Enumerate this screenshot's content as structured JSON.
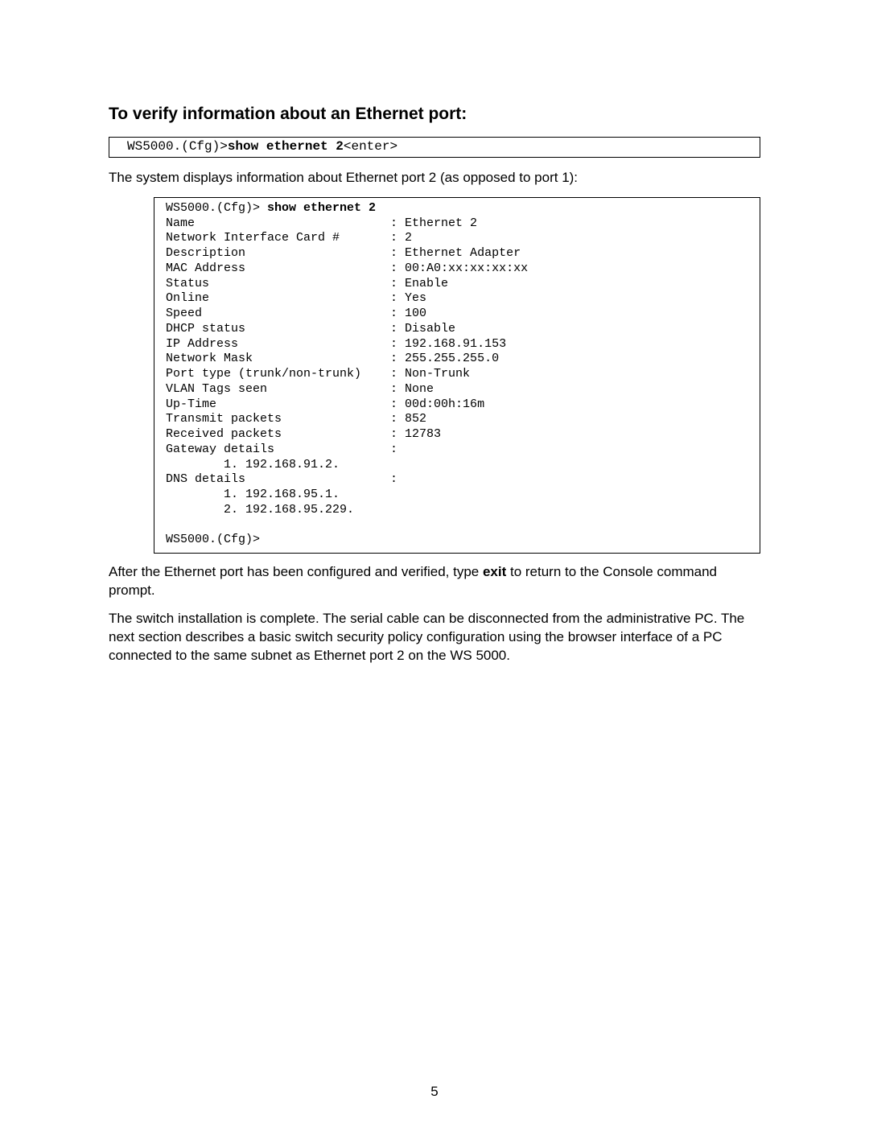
{
  "heading": "To verify information about an Ethernet port:",
  "cmd": {
    "prompt": "WS5000.(Cfg)>",
    "bold_cmd": "show ethernet 2",
    "suffix": "<enter>"
  },
  "intro_text": "The system displays information about Ethernet port 2 (as opposed to port 1):",
  "output": {
    "prompt_line_prefix": "WS5000.(Cfg)> ",
    "prompt_line_cmd": "show ethernet 2",
    "rows": [
      {
        "label": "Name",
        "value": "Ethernet 2"
      },
      {
        "label": "Network Interface Card #",
        "value": "2"
      },
      {
        "label": "Description",
        "value": "Ethernet Adapter"
      },
      {
        "label": "MAC Address",
        "value": "00:A0:xx:xx:xx:xx"
      },
      {
        "label": "Status",
        "value": "Enable"
      },
      {
        "label": "Online",
        "value": "Yes"
      },
      {
        "label": "Speed",
        "value": "100"
      },
      {
        "label": "DHCP status",
        "value": "Disable"
      },
      {
        "label": "IP Address",
        "value": "192.168.91.153"
      },
      {
        "label": "Network Mask",
        "value": "255.255.255.0"
      },
      {
        "label": "Port type (trunk/non-trunk)",
        "value": "Non-Trunk"
      },
      {
        "label": "VLAN Tags seen",
        "value": "None"
      },
      {
        "label": "Up-Time",
        "value": "00d:00h:16m"
      },
      {
        "label": "Transmit packets",
        "value": "852"
      },
      {
        "label": "Received packets",
        "value": "12783"
      }
    ],
    "gateway_label": "Gateway details",
    "gateway_items": [
      "1. 192.168.91.2."
    ],
    "dns_label": "DNS details",
    "dns_items": [
      "1. 192.168.95.1.",
      "2. 192.168.95.229."
    ],
    "end_prompt": "WS5000.(Cfg)>"
  },
  "para1_before": "After the Ethernet port has been configured and verified, type ",
  "para1_bold": "exit",
  "para1_after": " to return to the Console command prompt.",
  "para2": "The switch installation is complete. The serial cable can be disconnected from the administrative PC. The next section describes a basic switch security policy configuration using the browser interface of a PC connected to the same subnet as Ethernet port 2 on the WS 5000.",
  "page_number": "5"
}
